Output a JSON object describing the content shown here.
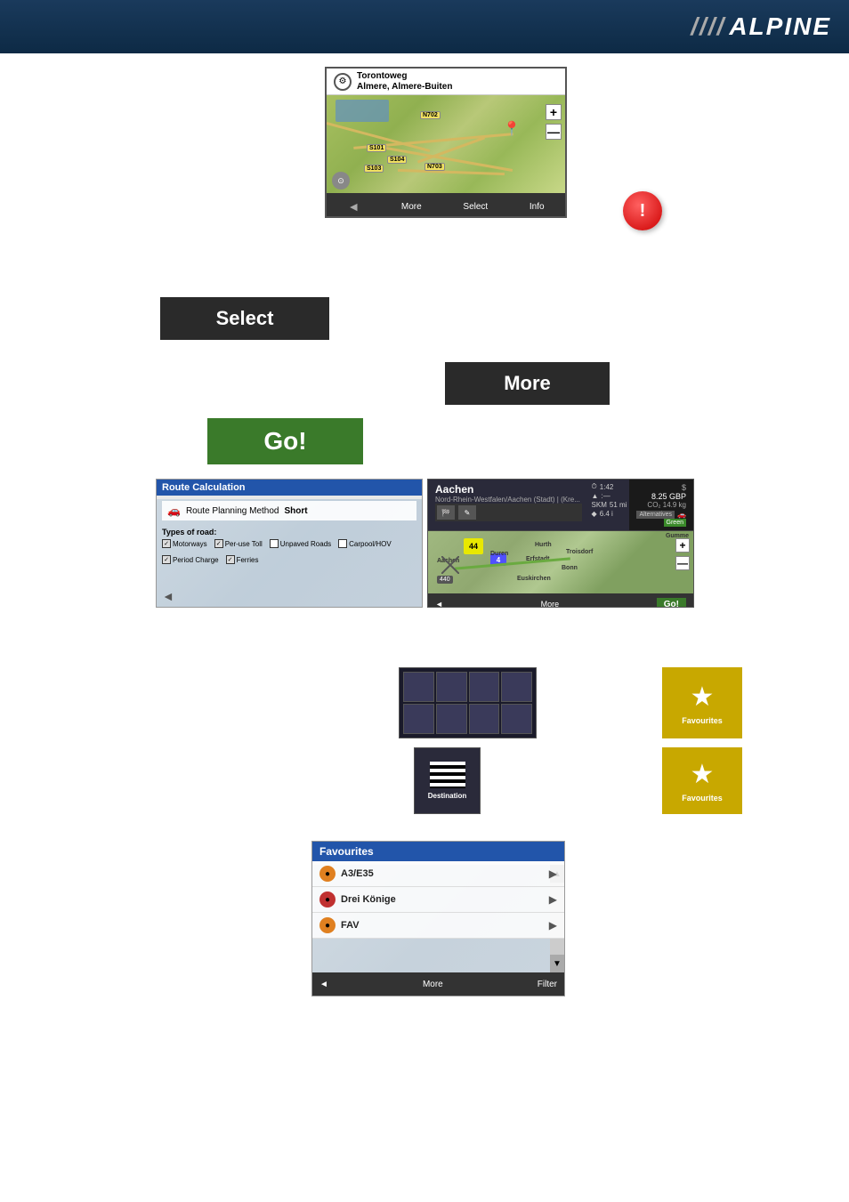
{
  "header": {
    "logo_slashes": "////",
    "logo_text": "ALPINE"
  },
  "top_map": {
    "title_line1": "Torontoweg",
    "title_line2": "Almere, Almere-Buiten",
    "road_labels": [
      "N702",
      "S101",
      "S104",
      "S103",
      "N703"
    ],
    "toolbar_buttons": [
      "More",
      "Select",
      "Info"
    ],
    "zoom_plus": "+",
    "zoom_minus": "—"
  },
  "select_button": {
    "label": "Select"
  },
  "more_button": {
    "label": "More"
  },
  "go_button": {
    "label": "Go!"
  },
  "route_calc": {
    "title": "Route Calculation",
    "method_label": "Route Planning Method",
    "method_value": "Short",
    "road_types_label": "Types of road:",
    "checkboxes": [
      {
        "label": "Motorways",
        "checked": true
      },
      {
        "label": "Per-use Toll",
        "checked": true
      },
      {
        "label": "Unpaved Roads",
        "checked": false
      },
      {
        "label": "Carpool/HOV",
        "checked": false
      },
      {
        "label": "Period Charge",
        "checked": true
      },
      {
        "label": "Ferries",
        "checked": true
      }
    ]
  },
  "nav_result": {
    "city": "Aachen",
    "sub": "Nord-Rhein-Westfalen/Aachen (Stadt) | (Kre...",
    "time": "1:42",
    "distance_label": "SKM",
    "distance": "51 mi",
    "fuel_cost": "8.25 GBP",
    "co2": "CO₂ 14.9 kg",
    "alternatives_label": "Alternatives",
    "route_type": "Green",
    "alt_text": "Alternatives",
    "bottom_buttons": [
      "More",
      "Go!"
    ],
    "map_cities": [
      "Aachen",
      "Duren",
      "Erfstadt",
      "Troisdorf",
      "Hurth",
      "Bonn",
      "Euskirchen",
      "Gumme"
    ]
  },
  "menu_grid": {
    "cells": 8
  },
  "favourites_top": {
    "label": "Favourites"
  },
  "destination_btn": {
    "label": "Destination"
  },
  "favourites_bottom": {
    "label": "Favourites"
  },
  "fav_list": {
    "title": "Favourites",
    "items": [
      {
        "name": "A3/E35",
        "icon_color": "orange"
      },
      {
        "name": "Drei Könige",
        "icon_color": "red"
      },
      {
        "name": "FAV",
        "icon_color": "orange"
      }
    ],
    "bottom_buttons": [
      "More",
      "Filter"
    ]
  }
}
